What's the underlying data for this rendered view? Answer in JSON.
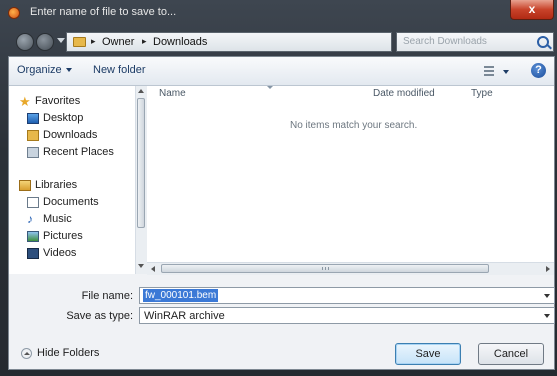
{
  "window": {
    "title": "Enter name of file to save to...",
    "close_label": "x"
  },
  "address": {
    "crumbs": [
      "Owner",
      "Downloads"
    ],
    "separator": "▸"
  },
  "search": {
    "placeholder": "Search Downloads"
  },
  "toolbar": {
    "organize": "Organize",
    "new_folder": "New folder",
    "help": "?"
  },
  "nav": {
    "favorites": "Favorites",
    "fav_items": [
      "Desktop",
      "Downloads",
      "Recent Places"
    ],
    "libraries": "Libraries",
    "lib_items": [
      "Documents",
      "Music",
      "Pictures",
      "Videos"
    ]
  },
  "columns": {
    "name": "Name",
    "date": "Date modified",
    "type": "Type"
  },
  "list": {
    "empty_message": "No items match your search."
  },
  "form": {
    "file_name_label": "File name:",
    "file_name_value": "fw_000101.bem",
    "save_type_label": "Save as type:",
    "save_type_value": "WinRAR archive"
  },
  "footer": {
    "hide_folders": "Hide Folders",
    "save": "Save",
    "cancel": "Cancel"
  }
}
